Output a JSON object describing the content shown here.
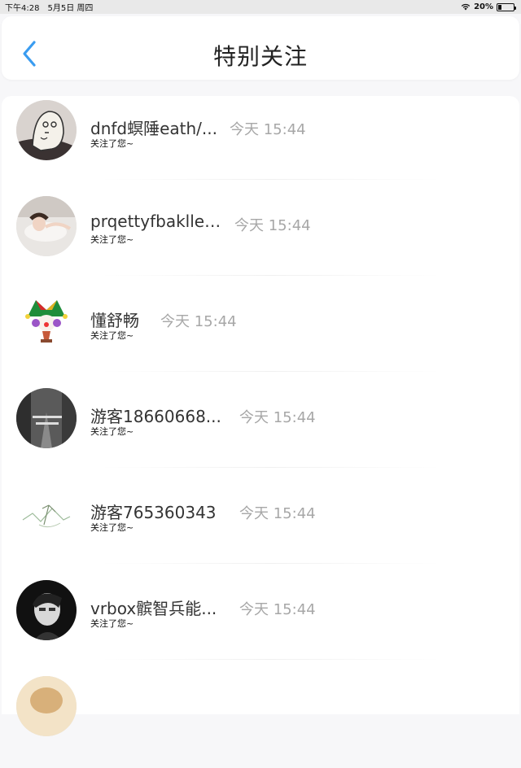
{
  "status_bar": {
    "time": "下午4:28",
    "date": "5月5日 周四",
    "battery_percent": "20%",
    "battery_level": 0.2
  },
  "header": {
    "title": "特别关注",
    "back_icon": "chevron-left-icon",
    "accent_color": "#3a9cf0"
  },
  "notifications": [
    {
      "name": "dnfd螟陲eath/...",
      "time": "今天 15:44",
      "action": "关注了您~"
    },
    {
      "name": "prqettyfbakllerі...",
      "time": "今天 15:44",
      "action": "关注了您~"
    },
    {
      "name": "懂舒畅",
      "time": "今天 15:44",
      "action": "关注了您~"
    },
    {
      "name": "游客18660668...",
      "time": "今天 15:44",
      "action": "关注了您~"
    },
    {
      "name": "游客765360343",
      "time": "今天 15:44",
      "action": "关注了您~"
    },
    {
      "name": "vrbox髌智兵能...",
      "time": "今天 15:44",
      "action": "关注了您~"
    }
  ]
}
